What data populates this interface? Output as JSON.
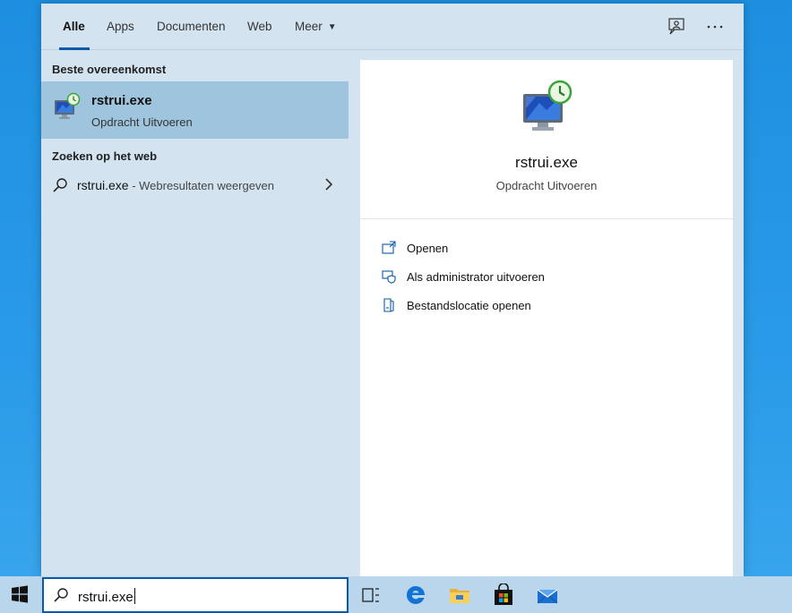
{
  "tabs": {
    "items": [
      {
        "label": "Alle"
      },
      {
        "label": "Apps"
      },
      {
        "label": "Documenten"
      },
      {
        "label": "Web"
      },
      {
        "label": "Meer"
      }
    ],
    "active": "Alle"
  },
  "left": {
    "best_match_header": "Beste overeenkomst",
    "best_match": {
      "title": "rstrui.exe",
      "subtitle": "Opdracht Uitvoeren"
    },
    "web_header": "Zoeken op het web",
    "web_result": {
      "query": "rstrui.exe",
      "suffix": " - Webresultaten weergeven"
    }
  },
  "right": {
    "title": "rstrui.exe",
    "subtitle": "Opdracht Uitvoeren",
    "actions": [
      {
        "label": "Openen",
        "icon": "open-icon"
      },
      {
        "label": "Als administrator uitvoeren",
        "icon": "admin-shield-icon"
      },
      {
        "label": "Bestandslocatie openen",
        "icon": "file-location-icon"
      }
    ]
  },
  "taskbar": {
    "search_value": "rstrui.exe",
    "apps": [
      "task-view-icon",
      "edge-icon",
      "file-explorer-icon",
      "store-icon",
      "mail-icon"
    ]
  },
  "colors": {
    "accent": "#0a5aa8",
    "panel_bg": "#d3e4f0",
    "selected_bg": "#9fc5de",
    "taskbar_bg": "#b9d6ec",
    "desktop_bg": "#2a9be8"
  }
}
